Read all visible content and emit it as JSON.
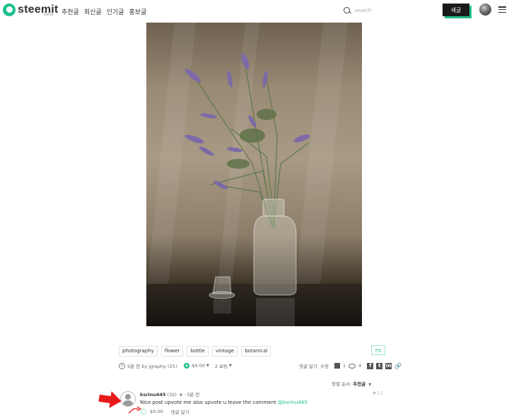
{
  "header": {
    "logo_text": "steemit",
    "logo_badge": "beta",
    "nav": [
      "추천글",
      "최신글",
      "인기글",
      "홍보글"
    ],
    "search_placeholder": "search",
    "write_label": "새글"
  },
  "post": {
    "image_alt": "Lavender in a glass bottle",
    "tags": [
      "photography",
      "flower",
      "bottle",
      "vintage",
      "botanical"
    ],
    "edit_label": "편집",
    "meta": {
      "time_author": "5분 전 by jgraphy (25)",
      "payout": "$0.00",
      "votes": "2 보팅"
    },
    "actions": {
      "reply": "댓글 달기",
      "edit": "수정",
      "replies_count": "1",
      "views_count": "4"
    }
  },
  "comments": {
    "sort_label": "정렬 순서:",
    "sort_value": "추천글",
    "items": [
      {
        "author": "ksrinu445",
        "reputation": "(32)",
        "time": "3분 전",
        "text": "Nice post upvote me also upvote u leave the comment ",
        "mention": "@ksrinu445",
        "payout": "$0.00",
        "reply_label": "댓글 달기",
        "tools": "[-]"
      }
    ]
  },
  "colors": {
    "brand": "#1fbf8f",
    "arrow": "#e8191b"
  }
}
